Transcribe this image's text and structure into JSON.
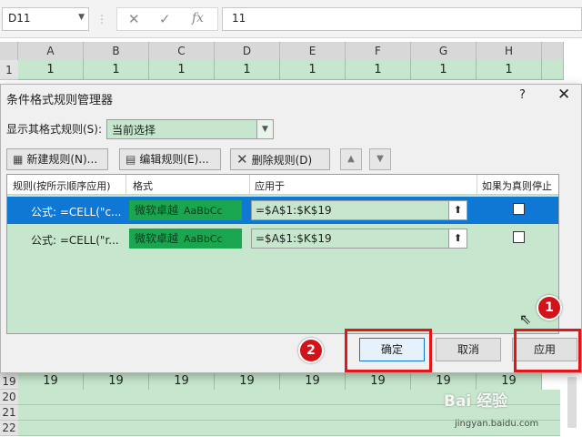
{
  "formula_bar": {
    "name_box": "D11",
    "cancel_icon": "✕",
    "enter_icon": "✓",
    "fx_icon": "fx",
    "value": "11"
  },
  "sheet": {
    "columns": [
      "A",
      "B",
      "C",
      "D",
      "E",
      "F",
      "G",
      "H"
    ],
    "row_1": {
      "num": "1",
      "values": [
        "1",
        "1",
        "1",
        "1",
        "1",
        "1",
        "1",
        "1"
      ]
    },
    "row_19": {
      "num": "19",
      "values": [
        "19",
        "19",
        "19",
        "19",
        "19",
        "19",
        "19",
        "19"
      ]
    },
    "rows_below": [
      "20",
      "21",
      "22"
    ]
  },
  "dialog": {
    "title": "条件格式规则管理器",
    "help": "?",
    "close": "✕",
    "show_rules_label": "显示其格式规则(S):",
    "show_rules_value": "当前选择",
    "toolbar": {
      "new_rule": "新建规则(N)...",
      "edit_rule": "编辑规则(E)...",
      "delete_rule": "删除规则(D)"
    },
    "columns": {
      "rule": "规则(按所示顺序应用)",
      "format": "格式",
      "applies_to": "应用于",
      "stop_if_true": "如果为真则停止"
    },
    "rules": [
      {
        "text": "公式: =CELL(\"c...",
        "preview_text": "微软卓越",
        "preview_sample": "AaBbCc",
        "applies_to": "=$A$1:$K$19",
        "selected": true
      },
      {
        "text": "公式: =CELL(\"r...",
        "preview_text": "微软卓越",
        "preview_sample": "AaBbCc",
        "applies_to": "=$A$1:$K$19",
        "selected": false
      }
    ],
    "buttons": {
      "ok": "确定",
      "cancel": "取消",
      "apply": "应用"
    }
  },
  "annotations": {
    "step_1": "1",
    "step_2": "2",
    "highlight_color": "#e0161b"
  },
  "watermark": {
    "logo": "Bai 经验",
    "url": "jingyan.baidu.com"
  }
}
